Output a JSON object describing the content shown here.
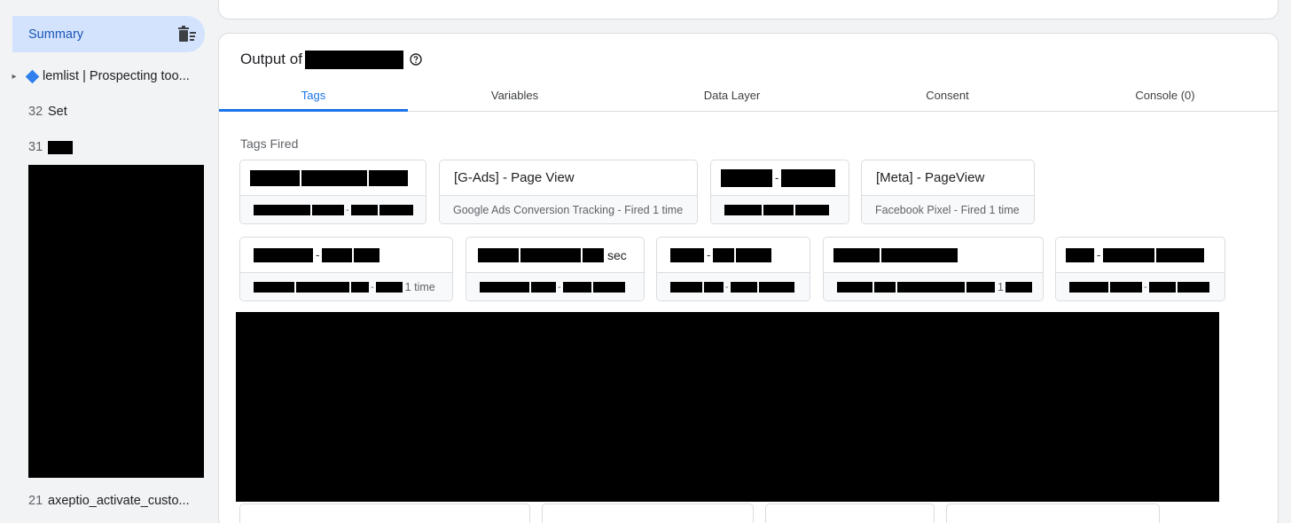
{
  "sidebar": {
    "summary_label": "Summary",
    "items": [
      {
        "num": "",
        "label": "lemlist | Prospecting too..."
      },
      {
        "num": "32",
        "label": "Set"
      },
      {
        "num": "31",
        "label": ""
      },
      {
        "num": "21",
        "label": "axeptio_activate_custo..."
      }
    ]
  },
  "panel": {
    "title": "Output of",
    "tabs": [
      "Tags",
      "Variables",
      "Data Layer",
      "Consent",
      "Console (0)"
    ],
    "section_label": "Tags Fired"
  },
  "tags": [
    {
      "name": "",
      "sub": ""
    },
    {
      "name": "[G-Ads] - Page View",
      "sub": "Google Ads Conversion Tracking - Fired 1 time"
    },
    {
      "name": "",
      "sub": ""
    },
    {
      "name": "[Meta] - PageView",
      "sub": "Facebook Pixel - Fired 1 time"
    },
    {
      "name": "",
      "sub": "1 time"
    },
    {
      "name": "sec",
      "sub": ""
    },
    {
      "name": "",
      "sub": ""
    },
    {
      "name": "",
      "sub": "1"
    },
    {
      "name": "",
      "sub": ""
    }
  ],
  "icons": {
    "summary_clear": "clear-list-icon",
    "title_help": "help-icon",
    "tree_caret": "caret-icon",
    "diamond": "diamond-icon"
  },
  "colors": {
    "accent": "#1a73e8",
    "summary_bg": "#d3e3fd",
    "page_bg": "#f1f3f4"
  }
}
